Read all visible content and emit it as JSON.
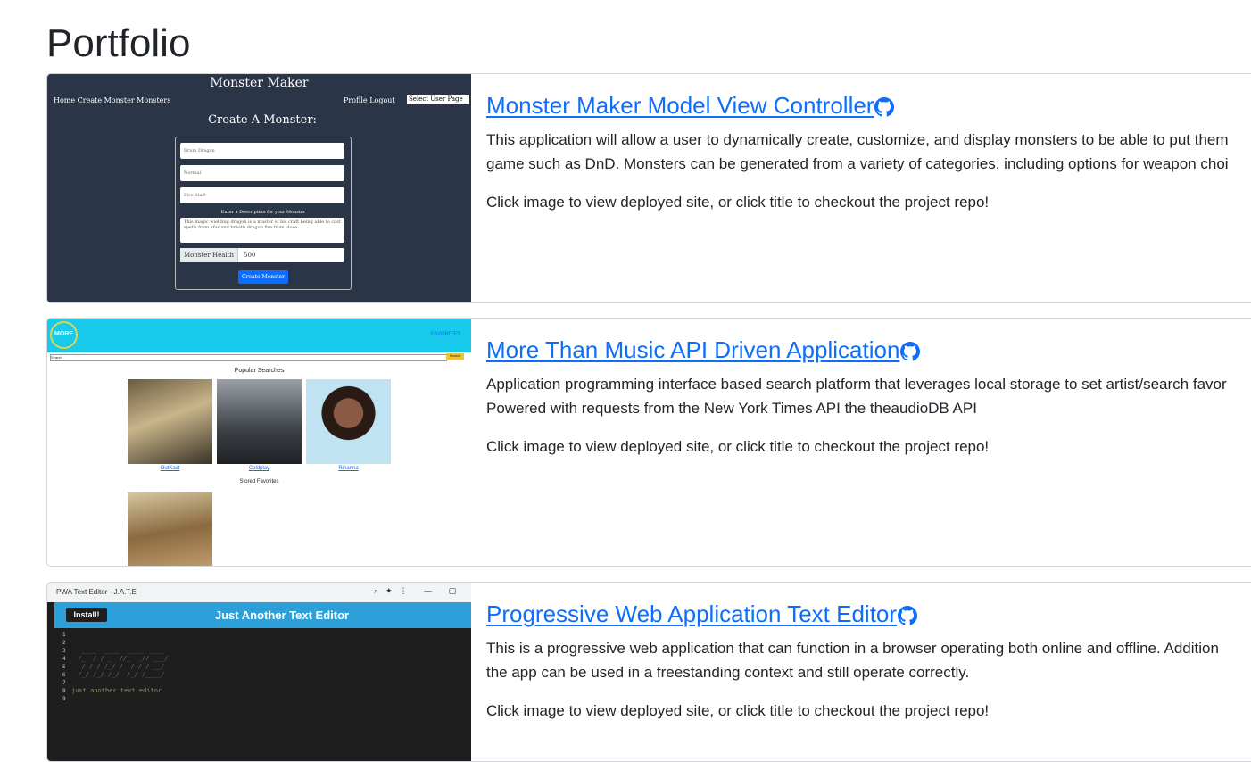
{
  "page": {
    "title": "Portfolio"
  },
  "projects": [
    {
      "title": "Monster Maker Model View Controller",
      "description_lines": [
        "This application will allow a user to dynamically create, customize, and display monsters to be able to put them",
        "game such as DnD. Monsters can be generated from a variety of categories, including options for weapon choi"
      ],
      "cta": "Click image to view deployed site, or click title to checkout the project repo!",
      "icon": "github-icon",
      "thumbnail": {
        "app_title": "Monster Maker",
        "nav_left": "Home  Create Monster  Monsters",
        "nav_right": "Profile  Logout",
        "select": "Select User Page",
        "heading": "Create A Monster:",
        "field1": "Drum Dragon",
        "field2": "Normal",
        "field3": "Fire Staff",
        "desc_label": "Enter a Description for your Monster",
        "desc_text": "This magic wielding dragon is a master of his craft being able to cast spells from afar and breath dragon fire from close",
        "health_label": "Monster Health",
        "health_value": "500",
        "button": "Create Monster"
      }
    },
    {
      "title": "More Than Music API Driven Application",
      "description_lines": [
        "Application programming interface based search platform that leverages local storage to set artist/search favor",
        "Powered with requests from the New York Times API the theaudioDB API"
      ],
      "cta": "Click image to view deployed site, or click title to checkout the project repo!",
      "icon": "github-icon",
      "thumbnail": {
        "logo": "MORE",
        "favorites": "FAVORITES",
        "search_value": "Search",
        "search_button": "Search",
        "popular": "Popular Searches",
        "artists": [
          "OutKast",
          "Coldplay",
          "Rihanna"
        ],
        "stored": "Stored Favorites"
      }
    },
    {
      "title": "Progressive Web Application Text Editor",
      "description_lines": [
        "This is a progressive web application that can function in a browser operating both online and offline. Addition",
        "the app can be used in a freestanding context and still operate correctly."
      ],
      "cta": "Click image to view deployed site, or click title to checkout the project repo!",
      "icon": "github-icon",
      "thumbnail": {
        "window_title": "PWA Text Editor - J.A.T.E",
        "install": "Install!",
        "header": "Just Another Text Editor",
        "code_comment": "just another text editor"
      }
    }
  ],
  "colors": {
    "link": "#0d6efd",
    "jate_header": "#2d9fd9",
    "mtm_band": "#17c9ea",
    "mm_bg": "#2a3547"
  }
}
